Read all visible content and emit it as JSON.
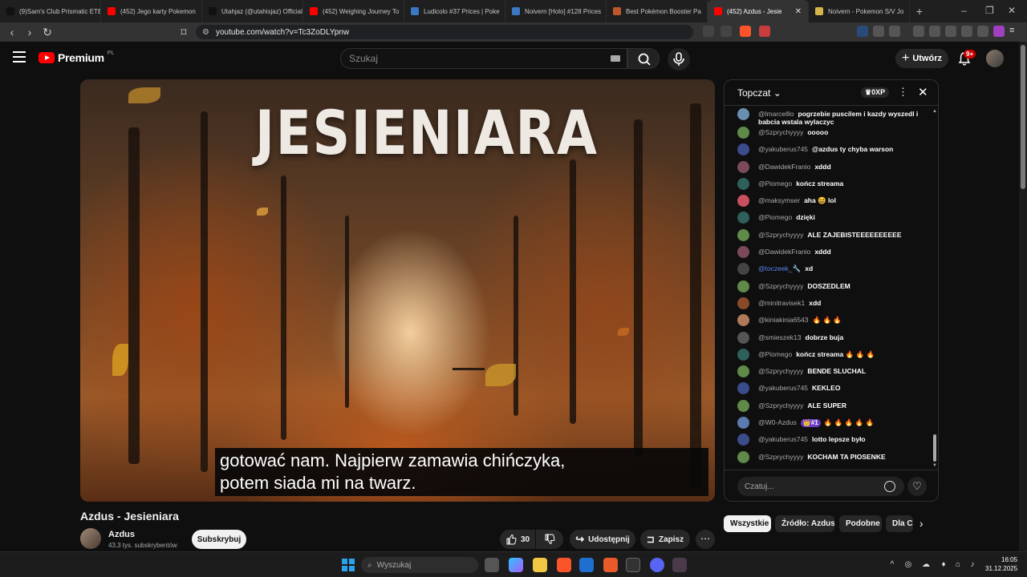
{
  "browser": {
    "tabs": [
      {
        "title": "(9)Sam's Club Prismatic ETB",
        "color": "#111111"
      },
      {
        "title": "(452) Jego karty Pokemon",
        "color": "#ff0000"
      },
      {
        "title": "Utahjaz (@utahisjaz) Official",
        "color": "#111111"
      },
      {
        "title": "(452) Weighing Journey To",
        "color": "#ff0000"
      },
      {
        "title": "Ludicolo #37 Prices | Poke",
        "color": "#3a78c3"
      },
      {
        "title": "Noivern [Holo] #128 Prices",
        "color": "#3a78c3"
      },
      {
        "title": "Best Pokémon Booster Pa",
        "color": "#c0572a"
      },
      {
        "title": "(452) Azdus - Jesie",
        "color": "#ff0000",
        "active": true
      },
      {
        "title": "Noivern - Pokemon S/V Jo",
        "color": "#d6b64a"
      }
    ],
    "url": "youtube.com/watch?v=Tc3ZoDLYpnw",
    "brave_badge": "3"
  },
  "youtube": {
    "logo_text": "Premium",
    "country": "PL",
    "search_placeholder": "Szukaj",
    "create_label": "Utwórz",
    "notif_count": "9+"
  },
  "video": {
    "overlay_title": "JESIENIARA",
    "subtitle_line1": "gotować nam. Najpierw zamawia chińczyka,",
    "subtitle_line2": "potem siada mi na twarz.",
    "title": "Azdus - Jesieniara",
    "channel": "Azdus",
    "subscribers": "43,3 tys. subskrybentów",
    "subscribe_label": "Subskrybuj",
    "likes": "30",
    "share_label": "Udostępnij",
    "save_label": "Zapisz"
  },
  "chat": {
    "mode": "Topczat",
    "xp": "0XP",
    "input_placeholder": "Czatuj...",
    "messages": [
      {
        "author": "@lmarcelllo",
        "text": "pogrzebie puscilem i kazdy wyszedl i babcia wstala wylaczyc",
        "av": "#6b8fb0"
      },
      {
        "author": "@Szprychyyyy",
        "text": "ooooo",
        "av": "#5f8a4a"
      },
      {
        "author": "@yakuberus745",
        "text": "@azdus ty chyba warson",
        "av": "#3b4c8a"
      },
      {
        "author": "@DawidekFranio",
        "text": "xddd",
        "av": "#7a4a5a"
      },
      {
        "author": "@Piomego",
        "text": "kończ streama",
        "av": "#2f5f5a"
      },
      {
        "author": "@maksymser",
        "text": "aha 😆 lol",
        "av": "#c85060"
      },
      {
        "author": "@Piomego",
        "text": "dzięki",
        "av": "#2f5f5a"
      },
      {
        "author": "@Szprychyyyy",
        "text": "ALE ZAJEBISTEEEEEEEEEE",
        "av": "#5f8a4a"
      },
      {
        "author": "@DawidekFranio",
        "text": "xddd",
        "av": "#7a4a5a"
      },
      {
        "author": "@toczeek_🔧",
        "text": "xd",
        "av": "#444444",
        "blue": true
      },
      {
        "author": "@Szprychyyyy",
        "text": "DOSZEDLEM",
        "av": "#5f8a4a"
      },
      {
        "author": "@minitravisek1",
        "text": "xdd",
        "av": "#8a4a2a"
      },
      {
        "author": "@kiniakinia6543",
        "text": "🔥 🔥 🔥",
        "av": "#b07a5a"
      },
      {
        "author": "@smieszek13",
        "text": "dobrze buja",
        "av": "#555555"
      },
      {
        "author": "@Piomego",
        "text": "kończ streama 🔥 🔥 🔥",
        "av": "#2f5f5a"
      },
      {
        "author": "@Szprychyyyy",
        "text": "BENDE SLUCHAL",
        "av": "#5f8a4a"
      },
      {
        "author": "@yakuberus745",
        "text": "KEKLEO",
        "av": "#3b4c8a"
      },
      {
        "author": "@Szprychyyyy",
        "text": "ALE SUPER",
        "av": "#5f8a4a"
      },
      {
        "author": "@W0-Azdus",
        "badge": "👑#1",
        "text": "🔥 🔥 🔥 🔥 🔥",
        "av": "#5a7ab0"
      },
      {
        "author": "@yakuberus745",
        "text": "lotto lepsze było",
        "av": "#3b4c8a"
      },
      {
        "author": "@Szprychyyyy",
        "text": "KOCHAM TA PIOSENKE",
        "av": "#5f8a4a"
      }
    ]
  },
  "chips": [
    "Wszystkie",
    "Źródło: Azdus",
    "Podobne",
    "Dla C"
  ],
  "taskbar": {
    "search_label": "Wyszukaj",
    "time": "16:05",
    "date": "31.12.2025"
  }
}
